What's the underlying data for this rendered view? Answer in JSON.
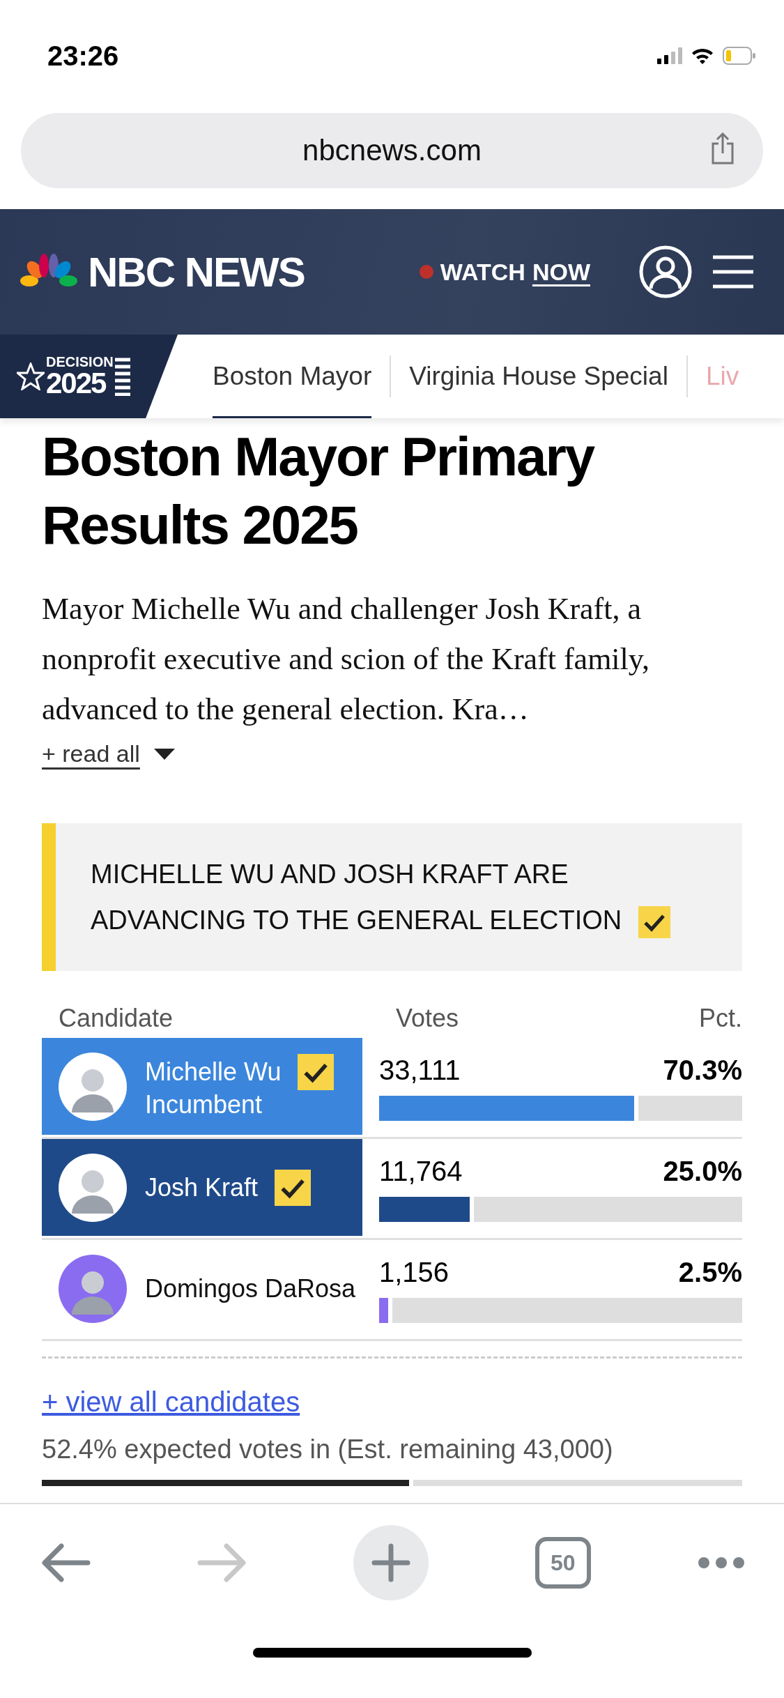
{
  "status_bar": {
    "time": "23:26"
  },
  "browser": {
    "url": "nbcnews.com",
    "tab_count": "50"
  },
  "site_header": {
    "logo": "NBC NEWS",
    "watch": "WATCH",
    "now": "NOW"
  },
  "section_nav": {
    "badge_top": "DECISION",
    "badge_year": "2025",
    "tabs": [
      {
        "label": "Boston Mayor",
        "selected": true
      },
      {
        "label": "Virginia House Special",
        "selected": false
      },
      {
        "label": "Liv",
        "selected": false
      }
    ]
  },
  "article": {
    "title": "Boston Mayor Primary Results 2025",
    "summary": "Mayor Michelle Wu and challenger Josh Kraft, a nonprofit executive and scion of the Kraft family, advanced to the general election. Kra…",
    "read_all": "+ read all"
  },
  "banner": {
    "text": "MICHELLE WU AND JOSH KRAFT ARE ADVANCING TO THE GENERAL ELECTION",
    "checked": true
  },
  "results": {
    "columns": [
      "Candidate",
      "Votes",
      "Pct."
    ],
    "candidates": [
      {
        "name": "Michelle Wu",
        "note": "Incumbent",
        "votes": "33,111",
        "pct": "70.3%",
        "level": 0.703,
        "advancing": true,
        "color": "#3b86dc"
      },
      {
        "name": "Josh Kraft",
        "votes": "11,764",
        "pct": "25.0%",
        "level": 0.25,
        "advancing": true,
        "color": "#1f4a8a"
      },
      {
        "name": "Domingos DaRosa",
        "votes": "1,156",
        "pct": "2.5%",
        "level": 0.025,
        "advancing": false,
        "color": "#8a6cf0"
      }
    ],
    "view_all": "+ view all candidates",
    "expected": "52.4% expected votes in (Est. remaining 43,000)",
    "level": 0.524
  }
}
